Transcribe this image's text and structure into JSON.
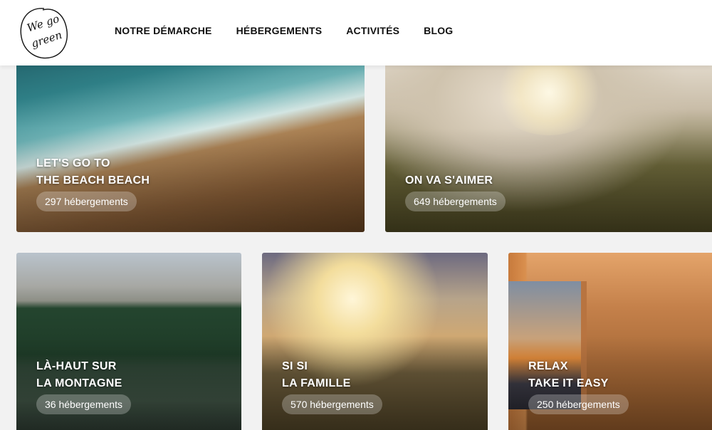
{
  "header": {
    "logo_text": "We go green",
    "nav": [
      {
        "label": "NOTRE DÉMARCHE"
      },
      {
        "label": "HÉBERGEMENTS"
      },
      {
        "label": "ACTIVITÉS"
      },
      {
        "label": "BLOG"
      }
    ]
  },
  "cards": [
    {
      "title_line1": "LET'S GO TO",
      "title_line2": "THE BEACH BEACH",
      "count": "297 hébergements"
    },
    {
      "title_line1": "",
      "title_line2": "ON VA S'AIMER",
      "count": "649 hébergements"
    },
    {
      "title_line1": "LÀ-HAUT SUR",
      "title_line2": "LA MONTAGNE",
      "count": "36 hébergements"
    },
    {
      "title_line1": "SI SI",
      "title_line2": "LA FAMILLE",
      "count": "570 hébergements"
    },
    {
      "title_line1": "RELAX",
      "title_line2": "TAKE IT EASY",
      "count": "250 hébergements"
    }
  ],
  "colors": {
    "header_bg": "#ffffff",
    "nav_text": "#111111",
    "card_text": "#ffffff"
  }
}
